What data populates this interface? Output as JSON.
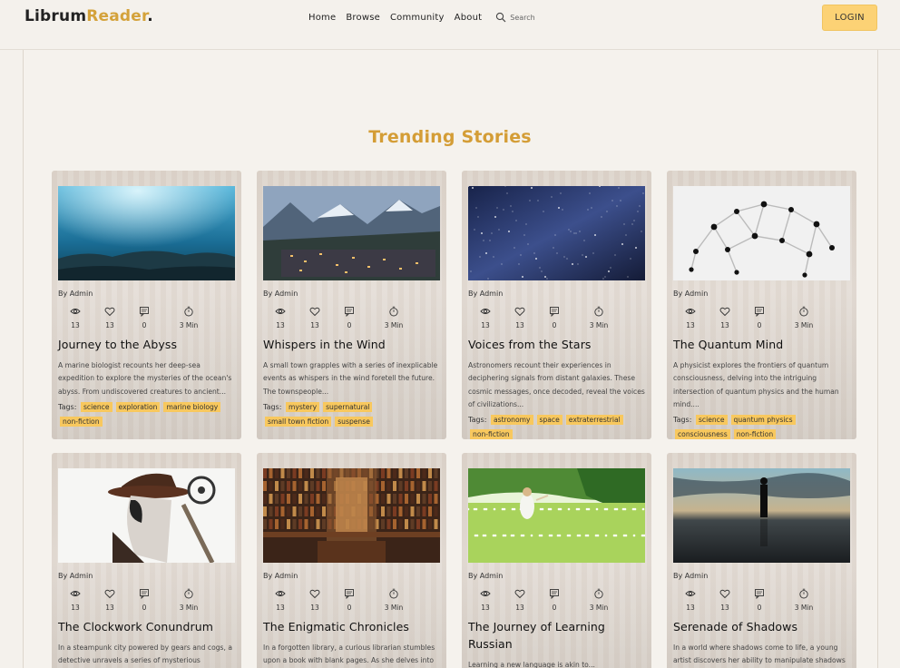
{
  "header": {
    "logo": {
      "part1": "Librum",
      "part2": "Reader",
      "part3": "."
    },
    "nav": [
      "Home",
      "Browse",
      "Community",
      "About"
    ],
    "search_placeholder": "Search",
    "login": "LOGIN"
  },
  "section_title": "Trending Stories",
  "colors": {
    "accent": "#d49d36",
    "tag": "#f8c85e",
    "login": "#fcd275"
  },
  "stat_icons": [
    "eye-icon",
    "heart-icon",
    "comment-icon",
    "timer-icon"
  ],
  "cards": [
    {
      "author": "By Admin",
      "views": "13",
      "likes": "13",
      "comments": "0",
      "read": "3 Min",
      "title": "Journey to the Abyss",
      "desc": "A marine biologist recounts her deep-sea expedition to explore the mysteries of the ocean's abyss. From undiscovered creatures to ancient...",
      "tags_label": "Tags:",
      "tags": [
        "science",
        "exploration",
        "marine biology",
        "non-fiction"
      ],
      "image": "ocean"
    },
    {
      "author": "By Admin",
      "views": "13",
      "likes": "13",
      "comments": "0",
      "read": "3 Min",
      "title": "Whispers in the Wind",
      "desc": "A small town grapples with a series of inexplicable events as whispers in the wind foretell the future. The townspeople...",
      "tags_label": "Tags:",
      "tags": [
        "mystery",
        "supernatural",
        "small town fiction",
        "suspense"
      ],
      "image": "town"
    },
    {
      "author": "By Admin",
      "views": "13",
      "likes": "13",
      "comments": "0",
      "read": "3 Min",
      "title": "Voices from the Stars",
      "desc": "Astronomers recount their experiences in deciphering signals from distant galaxies. These cosmic messages, once decoded, reveal the voices of civilizations...",
      "tags_label": "Tags:",
      "tags": [
        "astronomy",
        "space",
        "extraterrestrial",
        "non-fiction"
      ],
      "image": "stars"
    },
    {
      "author": "By Admin",
      "views": "13",
      "likes": "13",
      "comments": "0",
      "read": "3 Min",
      "title": "The Quantum Mind",
      "desc": "A physicist explores the frontiers of quantum consciousness, delving into the intriguing intersection of quantum physics and the human mind....",
      "tags_label": "Tags:",
      "tags": [
        "science",
        "quantum physics",
        "consciousness",
        "non-fiction"
      ],
      "image": "molecule"
    },
    {
      "author": "By Admin",
      "views": "13",
      "likes": "13",
      "comments": "0",
      "read": "3 Min",
      "title": "The Clockwork Conundrum",
      "desc": "In a steampunk city powered by gears and cogs, a detective unravels a series of mysterious clockwork crimes. As he...",
      "tags_label": "",
      "tags": [],
      "image": "steampunk"
    },
    {
      "author": "By Admin",
      "views": "13",
      "likes": "13",
      "comments": "0",
      "read": "3 Min",
      "title": "The Enigmatic Chronicles",
      "desc": "In a forgotten library, a curious librarian stumbles upon a book with blank pages. As she delves into its mystery...",
      "tags_label": "",
      "tags": [],
      "image": "library"
    },
    {
      "author": "By Admin",
      "views": "13",
      "likes": "13",
      "comments": "0",
      "read": "3 Min",
      "title": "The Journey of Learning Russian",
      "desc": "Learning a new language is akin to...",
      "tags_label": "",
      "tags": [],
      "image": "meadow"
    },
    {
      "author": "By Admin",
      "views": "13",
      "likes": "13",
      "comments": "0",
      "read": "3 Min",
      "title": "Serenade of Shadows",
      "desc": "In a world where shadows come to life, a young artist discovers her ability to manipulate shadows through her...",
      "tags_label": "",
      "tags": [],
      "image": "shadow"
    }
  ]
}
